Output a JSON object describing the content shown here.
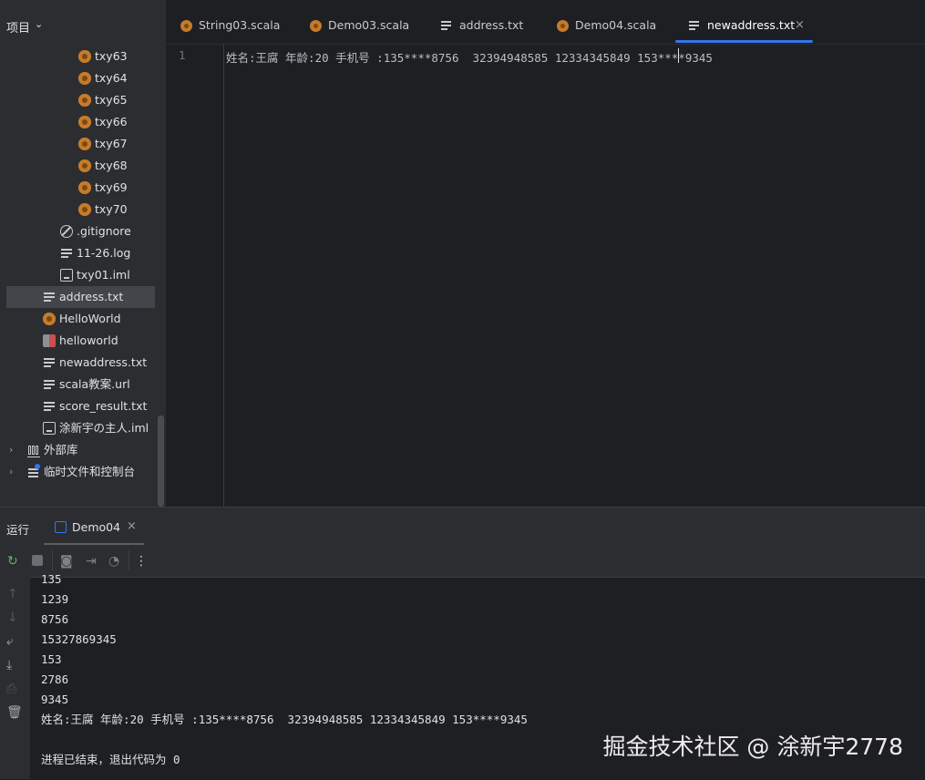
{
  "project_panel": {
    "title": "项目",
    "items": [
      {
        "label": "txy63",
        "icon": "scala-file-icon"
      },
      {
        "label": "txy64",
        "icon": "scala-file-icon"
      },
      {
        "label": "txy65",
        "icon": "scala-file-icon"
      },
      {
        "label": "txy66",
        "icon": "scala-file-icon"
      },
      {
        "label": "txy67",
        "icon": "scala-file-icon"
      },
      {
        "label": "txy68",
        "icon": "scala-file-icon"
      },
      {
        "label": "txy69",
        "icon": "scala-file-icon"
      },
      {
        "label": "txy70",
        "icon": "scala-file-icon"
      },
      {
        "label": ".gitignore",
        "icon": "ignore-icon"
      },
      {
        "label": "11-26.log",
        "icon": "text-file-icon"
      },
      {
        "label": "txy01.iml",
        "icon": "iml-file-icon"
      },
      {
        "label": "address.txt",
        "icon": "text-file-icon"
      },
      {
        "label": "HelloWorld",
        "icon": "scala-file-icon"
      },
      {
        "label": "helloworld",
        "icon": "class-file-icon"
      },
      {
        "label": "newaddress.txt",
        "icon": "text-file-icon"
      },
      {
        "label": "scala教案.url",
        "icon": "text-file-icon"
      },
      {
        "label": "score_result.txt",
        "icon": "text-file-icon"
      },
      {
        "label": "涂新宇の主人.iml",
        "icon": "iml-file-icon"
      },
      {
        "label": "外部库",
        "icon": "library-icon"
      },
      {
        "label": "临时文件和控制台",
        "icon": "scratch-icon"
      }
    ]
  },
  "editor": {
    "tabs": [
      {
        "label": "String03.scala",
        "icon": "scala-file-icon"
      },
      {
        "label": "Demo03.scala",
        "icon": "scala-file-icon"
      },
      {
        "label": "address.txt",
        "icon": "text-file-icon"
      },
      {
        "label": "Demo04.scala",
        "icon": "scala-file-icon"
      },
      {
        "label": "newaddress.txt",
        "icon": "text-file-icon",
        "active": true,
        "close": "×"
      }
    ],
    "line_number": "1",
    "line_text": "姓名:王腐 年龄:20 手机号 :135****8756  32394948585 12334345849 153****9345"
  },
  "run_panel": {
    "title": "运行",
    "tab_label": "Demo04",
    "tab_close": "×",
    "console_lines": [
      "135",
      "1239",
      "8756",
      "15327869345",
      "153",
      "2786",
      "9345",
      "姓名:王腐 年龄:20 手机号 :135****8756  32394948585 12334345849 153****9345",
      "",
      "进程已结束，退出代码为 0"
    ]
  },
  "watermark": "掘金技术社区 @ 涂新宇2778",
  "colors": {
    "background": "#1e1f22",
    "panel": "#2b2d30",
    "accent": "#3574f0",
    "scala_icon": "#c67b2a"
  }
}
